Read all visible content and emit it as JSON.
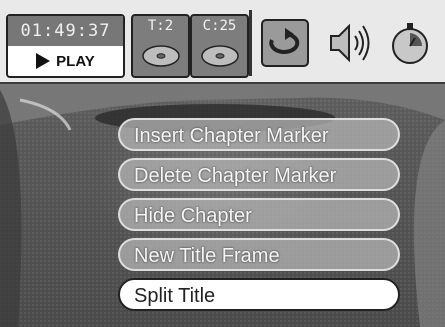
{
  "status": {
    "time": "01:49:37",
    "play_label": "PLAY",
    "title_indicator": "T:2",
    "chapter_indicator": "C:25"
  },
  "icons": [
    "repeat-icon",
    "audio-icon",
    "timer-icon"
  ],
  "menu": {
    "items": [
      {
        "label": "Insert Chapter Marker"
      },
      {
        "label": "Delete Chapter Marker"
      },
      {
        "label": "Hide Chapter"
      },
      {
        "label": "New Title Frame"
      },
      {
        "label": "Split Title"
      }
    ],
    "selected_index": 4
  }
}
